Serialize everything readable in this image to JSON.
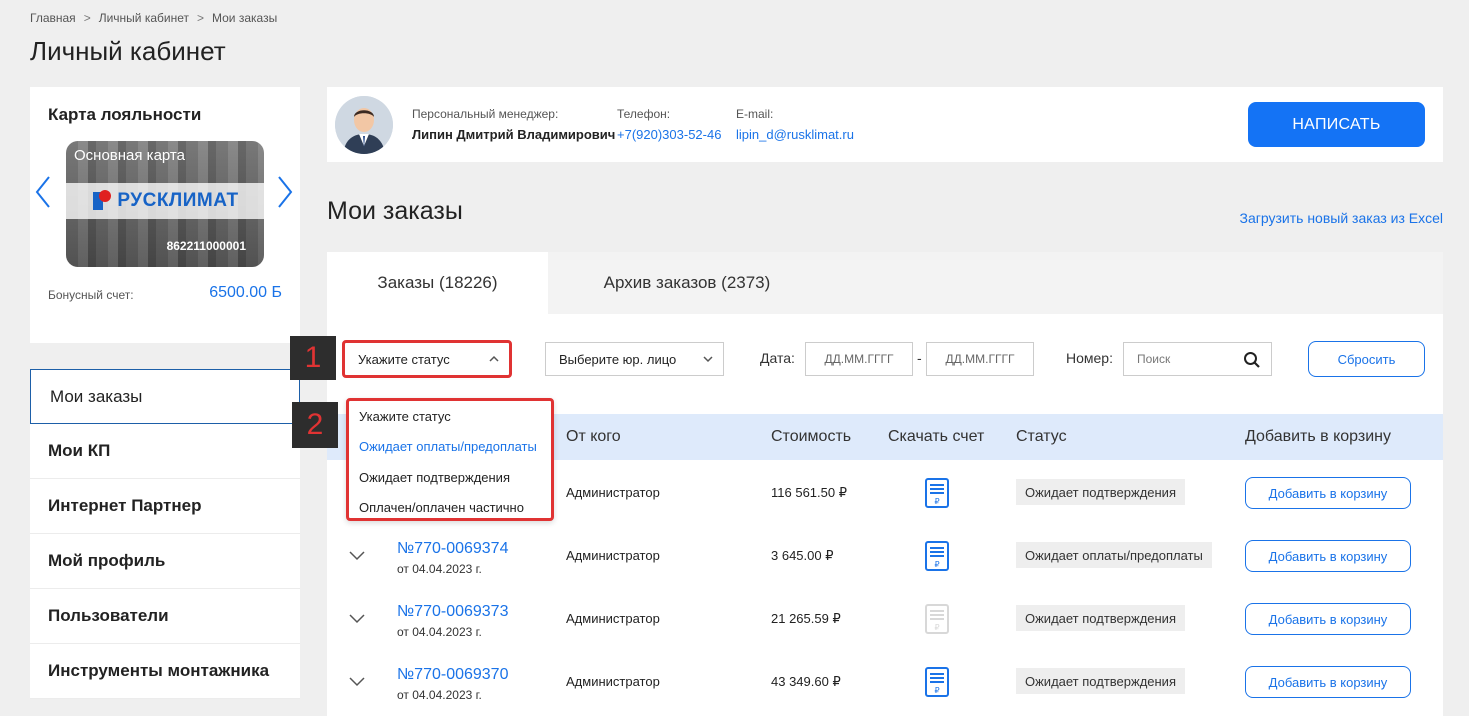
{
  "breadcrumb": [
    "Главная",
    "Личный кабинет",
    "Мои заказы"
  ],
  "breadcrumb_sep": ">",
  "page_title": "Личный кабинет",
  "loyalty": {
    "title": "Карта лояльности",
    "card_name": "Основная карта",
    "card_brand": "РУСКЛИМАТ",
    "card_number": "862211000001",
    "bonus_label": "Бонусный счет:",
    "bonus_value": "6500.00 Б"
  },
  "menu": [
    {
      "label": "Мои заказы",
      "active": true
    },
    {
      "label": "Мои КП"
    },
    {
      "label": "Интернет Партнер"
    },
    {
      "label": "Мой профиль"
    },
    {
      "label": "Пользователи"
    },
    {
      "label": "Инструменты монтажника"
    }
  ],
  "manager": {
    "manager_label": "Персональный менеджер:",
    "manager_name": "Липин Дмитрий Владимирович",
    "phone_label": "Телефон:",
    "phone": "+7(920)303-52-46",
    "email_label": "E-mail:",
    "email": "lipin_d@rusklimat.ru",
    "write_button": "НАПИСАТЬ"
  },
  "orders_title": "Мои заказы",
  "excel_link": "Загрузить новый заказ из Excel",
  "tabs": [
    "Заказы (18226)",
    "Архив заказов (2373)"
  ],
  "filters": {
    "status_placeholder": "Укажите статус",
    "entity_placeholder": "Выберите юр. лицо",
    "date_label": "Дата:",
    "date_from": "ДД.ММ.ГГГГ",
    "date_sep": "-",
    "date_to": "ДД.ММ.ГГГГ",
    "number_label": "Номер:",
    "search_placeholder": "Поиск",
    "reset_button": "Сбросить"
  },
  "status_dropdown": [
    "Укажите статус",
    "Ожидает оплаты/предоплаты",
    "Ожидает подтверждения",
    "Оплачен/оплачен частично"
  ],
  "columns": [
    "От кого",
    "Стоимость",
    "Скачать счет",
    "Статус",
    "Добавить в корзину"
  ],
  "rows": [
    {
      "number": "",
      "date": "",
      "from": "Администратор",
      "cost": "116 561.50 ₽",
      "status": "Ожидает подтверждения",
      "add": "Добавить в корзину"
    },
    {
      "number": "№770-0069374",
      "date": "от 04.04.2023 г.",
      "from": "Администратор",
      "cost": "3 645.00 ₽",
      "status": "Ожидает оплаты/предоплаты",
      "add": "Добавить в корзину"
    },
    {
      "number": "№770-0069373",
      "date": "от 04.04.2023 г.",
      "from": "Администратор",
      "cost": "21 265.59 ₽",
      "status": "Ожидает подтверждения",
      "add": "Добавить в корзину"
    },
    {
      "number": "№770-0069370",
      "date": "от 04.04.2023 г.",
      "from": "Администратор",
      "cost": "43 349.60 ₽",
      "status": "Ожидает подтверждения",
      "add": "Добавить в корзину"
    }
  ],
  "annotations": [
    "1",
    "2"
  ],
  "colors": {
    "accent": "#1a73e8",
    "button": "#1473f5",
    "highlight": "#e03333",
    "table_header": "#deeafb"
  }
}
